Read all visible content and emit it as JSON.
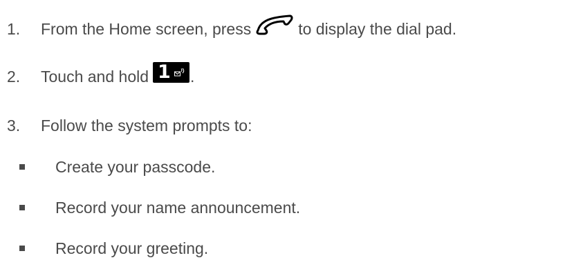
{
  "steps": [
    {
      "number": "1.",
      "text_before": "From the Home screen, press",
      "icon": "talk-key-icon",
      "text_after": "to display the dial pad."
    },
    {
      "number": "2.",
      "text_before": "Touch and hold",
      "key_label": "1",
      "icon": "voicemail-key-1-icon",
      "text_after": "."
    },
    {
      "number": "3.",
      "text": "Follow the system prompts to:"
    }
  ],
  "sub_items": [
    "Create your passcode.",
    "Record your name announcement.",
    "Record your greeting."
  ]
}
